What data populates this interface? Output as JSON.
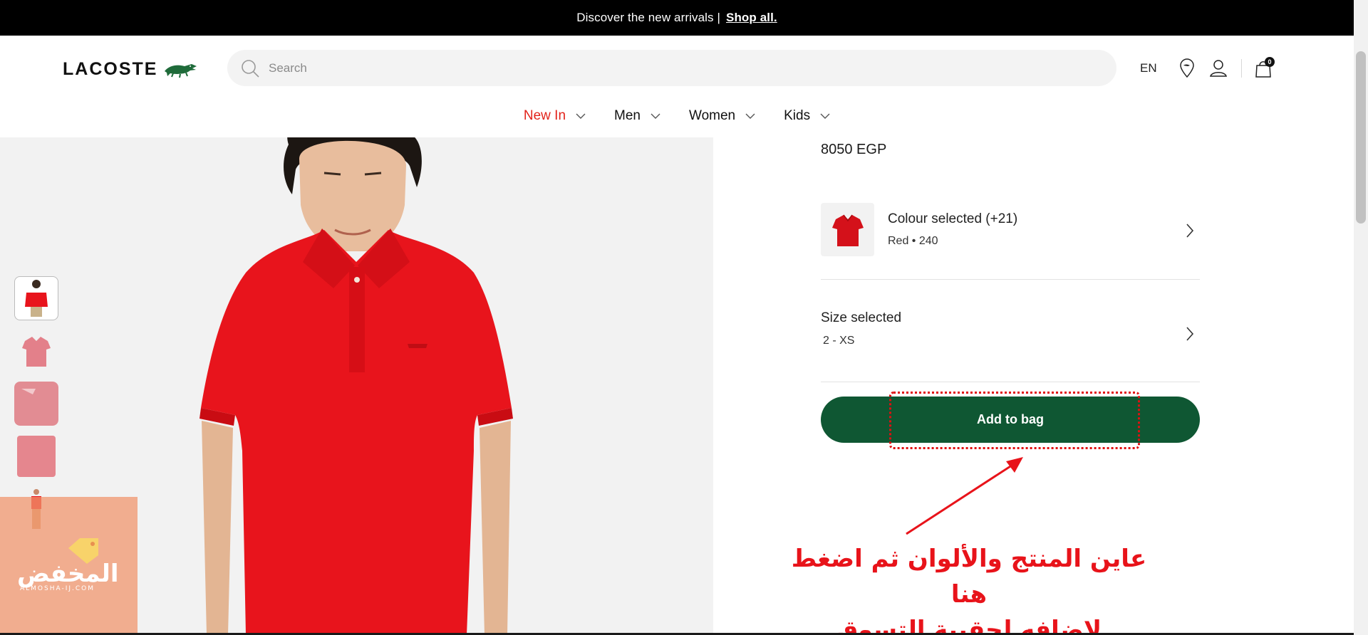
{
  "promo": {
    "text": "Discover the new arrivals |",
    "link": "Shop all."
  },
  "header": {
    "brand": "LACOSTE",
    "search_placeholder": "Search",
    "language": "EN",
    "bag_count": "0"
  },
  "nav": [
    {
      "label": "New In",
      "active": true
    },
    {
      "label": "Men",
      "active": false
    },
    {
      "label": "Women",
      "active": false
    },
    {
      "label": "Kids",
      "active": false
    }
  ],
  "product": {
    "price": "8050 EGP",
    "colour_title": "Colour selected (+21)",
    "colour_value": "Red • 240",
    "size_title": "Size selected",
    "size_value": "2 - XS",
    "add_button": "Add to bag"
  },
  "colors": {
    "accent_red": "#e2231a",
    "button_green": "#0f5733",
    "product_red": "#e8141c"
  },
  "annotation": {
    "line1": "عاين المنتج والألوان ثم اضغط هنا",
    "line2": "لإضافه لحقيبة التسوق"
  },
  "watermark": {
    "name": "المخفض",
    "site": "ALMOSHA-IJ.COM"
  }
}
